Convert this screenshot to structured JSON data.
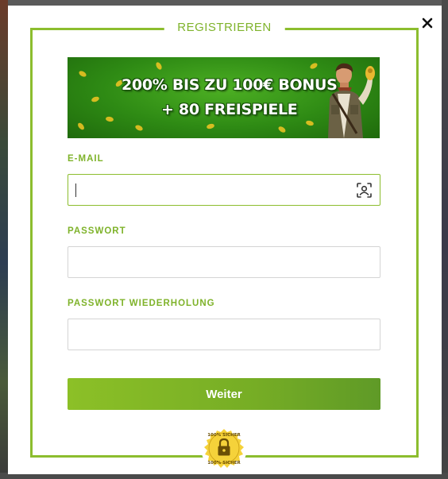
{
  "modal": {
    "title": "REGISTRIEREN",
    "close_icon": "close-icon"
  },
  "banner": {
    "line1": "200% BIS ZU 100€ BONUS",
    "line2": "+ 80 FREISPIELE"
  },
  "form": {
    "email_label": "E-MAIL",
    "email_value": "",
    "password_label": "PASSWORT",
    "password_value": "",
    "password_repeat_label": "PASSWORT WIEDERHOLUNG",
    "password_repeat_value": "",
    "submit_label": "Weiter",
    "email_icon": "contact-autofill-icon"
  },
  "seal": {
    "text": "100% SICHER",
    "icon": "lock-icon"
  },
  "colors": {
    "accent": "#8cbd2e",
    "label": "#7fb32b",
    "button_start": "#8cc027",
    "button_end": "#5f9a27",
    "seal": "#f5d23a"
  }
}
